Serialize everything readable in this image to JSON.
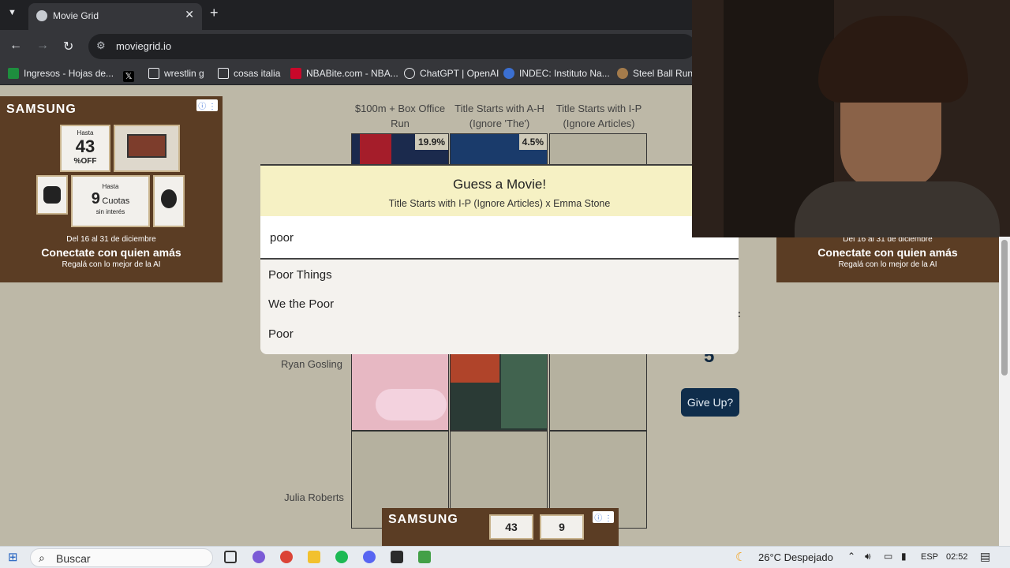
{
  "browser": {
    "tab_title": "Movie Grid",
    "url": "moviegrid.io",
    "bookmarks": [
      "Ingresos - Hojas de...",
      "",
      "wrestlin g",
      "cosas italia",
      "NBABite.com - NBA...",
      "ChatGPT | OpenAI",
      "INDEC: Instituto Na...",
      "Steel Ball Run M"
    ]
  },
  "ads": {
    "brand": "SAMSUNG",
    "discount": "43",
    "discount_suffix": "%OFF",
    "cuotas_prefix": "Hasta",
    "cuotas_num": "9",
    "cuotas_label": "Cuotas",
    "cuotas_sub": "sin interés",
    "date": "Del 16 al 31 de diciembre",
    "headline": "Conectate con quien amás",
    "subline": "Regalá con lo mejor de la AI"
  },
  "grid": {
    "columns": [
      "$100m + Box Office Run",
      "Title Starts with A-H (Ignore 'The')",
      "Title Starts with I-P (Ignore Articles)"
    ],
    "rows": [
      "Emma Stone",
      "Ryan Gosling",
      "Julia Roberts"
    ],
    "percentages": [
      "19.9%",
      "4.5%"
    ]
  },
  "modal": {
    "title": "Guess a Movie!",
    "subtitle": "Title Starts with I-P (Ignore Articles) x Emma Stone",
    "search_value": "poor",
    "suggestions": [
      "Poor Things",
      "We the Poor",
      "Poor"
    ]
  },
  "sidebar": {
    "guesses_label": "T:",
    "guesses_count": "5",
    "give_up_label": "Give Up?"
  },
  "taskbar": {
    "search_label": "Buscar",
    "weather": "26°C  Despejado",
    "lang": "ESP",
    "time": "02:52"
  }
}
